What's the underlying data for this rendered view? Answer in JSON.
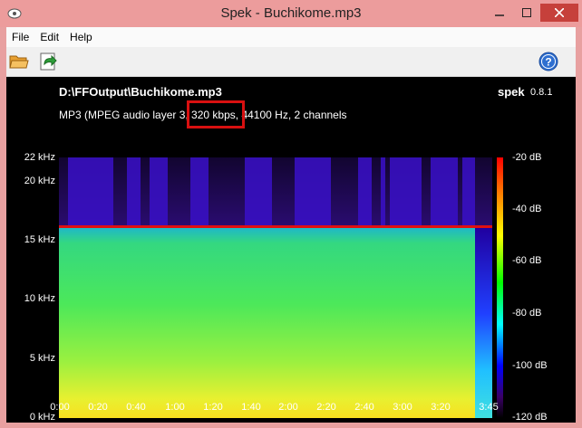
{
  "window": {
    "title": "Spek - Buchikome.mp3"
  },
  "menu": [
    "File",
    "Edit",
    "Help"
  ],
  "toolbar": {
    "open_icon": "folder-open-icon",
    "save_icon": "save-icon",
    "help_icon": "help-icon"
  },
  "file": {
    "path": "D:\\FFOutput\\Buchikome.mp3",
    "info_before": "MP3 (MPEG audio layer 3",
    "info_bitrate": ", 320 kbps,",
    "info_after": " 44100 Hz, 2 channels"
  },
  "brand": {
    "name": "spek",
    "version": "0.8.1"
  },
  "spectrogram": {
    "freq_ticks": [
      "22 kHz",
      "20 kHz",
      "15 kHz",
      "10 kHz",
      "5 kHz",
      "0 kHz"
    ],
    "time_ticks": [
      "0:00",
      "0:20",
      "0:40",
      "1:00",
      "1:20",
      "1:40",
      "2:00",
      "2:20",
      "2:40",
      "3:00",
      "3:20",
      "3:45"
    ],
    "db_ticks": [
      "-20 dB",
      "-40 dB",
      "-60 dB",
      "-80 dB",
      "-100 dB",
      "-120 dB"
    ],
    "cutoff_khz": 16,
    "duration": "3:45"
  },
  "colors": {
    "titlebar": "#ec9c9c",
    "close": "#c6403b",
    "highlight": "#d81010",
    "cutoff_line": "#e01010"
  }
}
